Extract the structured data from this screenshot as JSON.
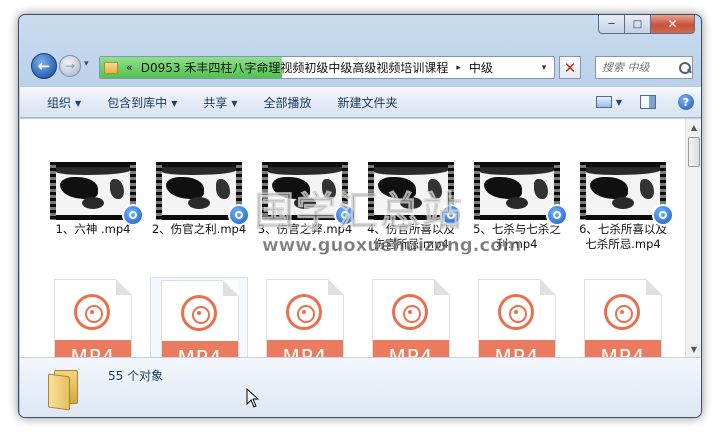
{
  "window": {
    "caption": {
      "minimize": "─",
      "maximize": "□",
      "close": "✕"
    }
  },
  "nav": {
    "back": "←",
    "forward": "→",
    "history": "▾",
    "address": {
      "progress": 0.4,
      "chevron": "«",
      "segments": [
        "D0953 禾丰四柱八字命理视频初级中级高级视频培训课程",
        "中级"
      ],
      "separator": "▸",
      "dropdown": "▾"
    },
    "stop": "✕",
    "search": {
      "placeholder": "搜索 中级"
    }
  },
  "toolbar": {
    "organize": "组织",
    "include_library": "包含到库中",
    "share": "共享",
    "play_all": "全部播放",
    "new_folder": "新建文件夹",
    "arrow": "▼",
    "help": "?"
  },
  "files": {
    "videos": [
      {
        "label": "1、六神 .mp4"
      },
      {
        "label": "2、伤官之利.mp4"
      },
      {
        "label": "3、伤官之弊.mp4"
      },
      {
        "label": "4、伤官所喜以及伤官所忌.mp4"
      },
      {
        "label": "5、七杀与七杀之利.mp4"
      },
      {
        "label": "6、七杀所喜以及七杀所忌.mp4"
      }
    ],
    "mp4_icons": [
      {
        "text": "MP4"
      },
      {
        "text": "MP4"
      },
      {
        "text": "MP4"
      },
      {
        "text": "MP4"
      },
      {
        "text": "MP4"
      },
      {
        "text": "MP4"
      }
    ]
  },
  "scrollbar": {
    "up": "▲",
    "down": "▼"
  },
  "watermark": {
    "title": "国学汇总站",
    "url": "www.guoxuehuizong.com"
  },
  "status": {
    "object_count": "55 个对象"
  },
  "colors": {
    "accent": "#1e395b",
    "mp4_band": "#ea7b5f",
    "progress": "#52c14d"
  }
}
